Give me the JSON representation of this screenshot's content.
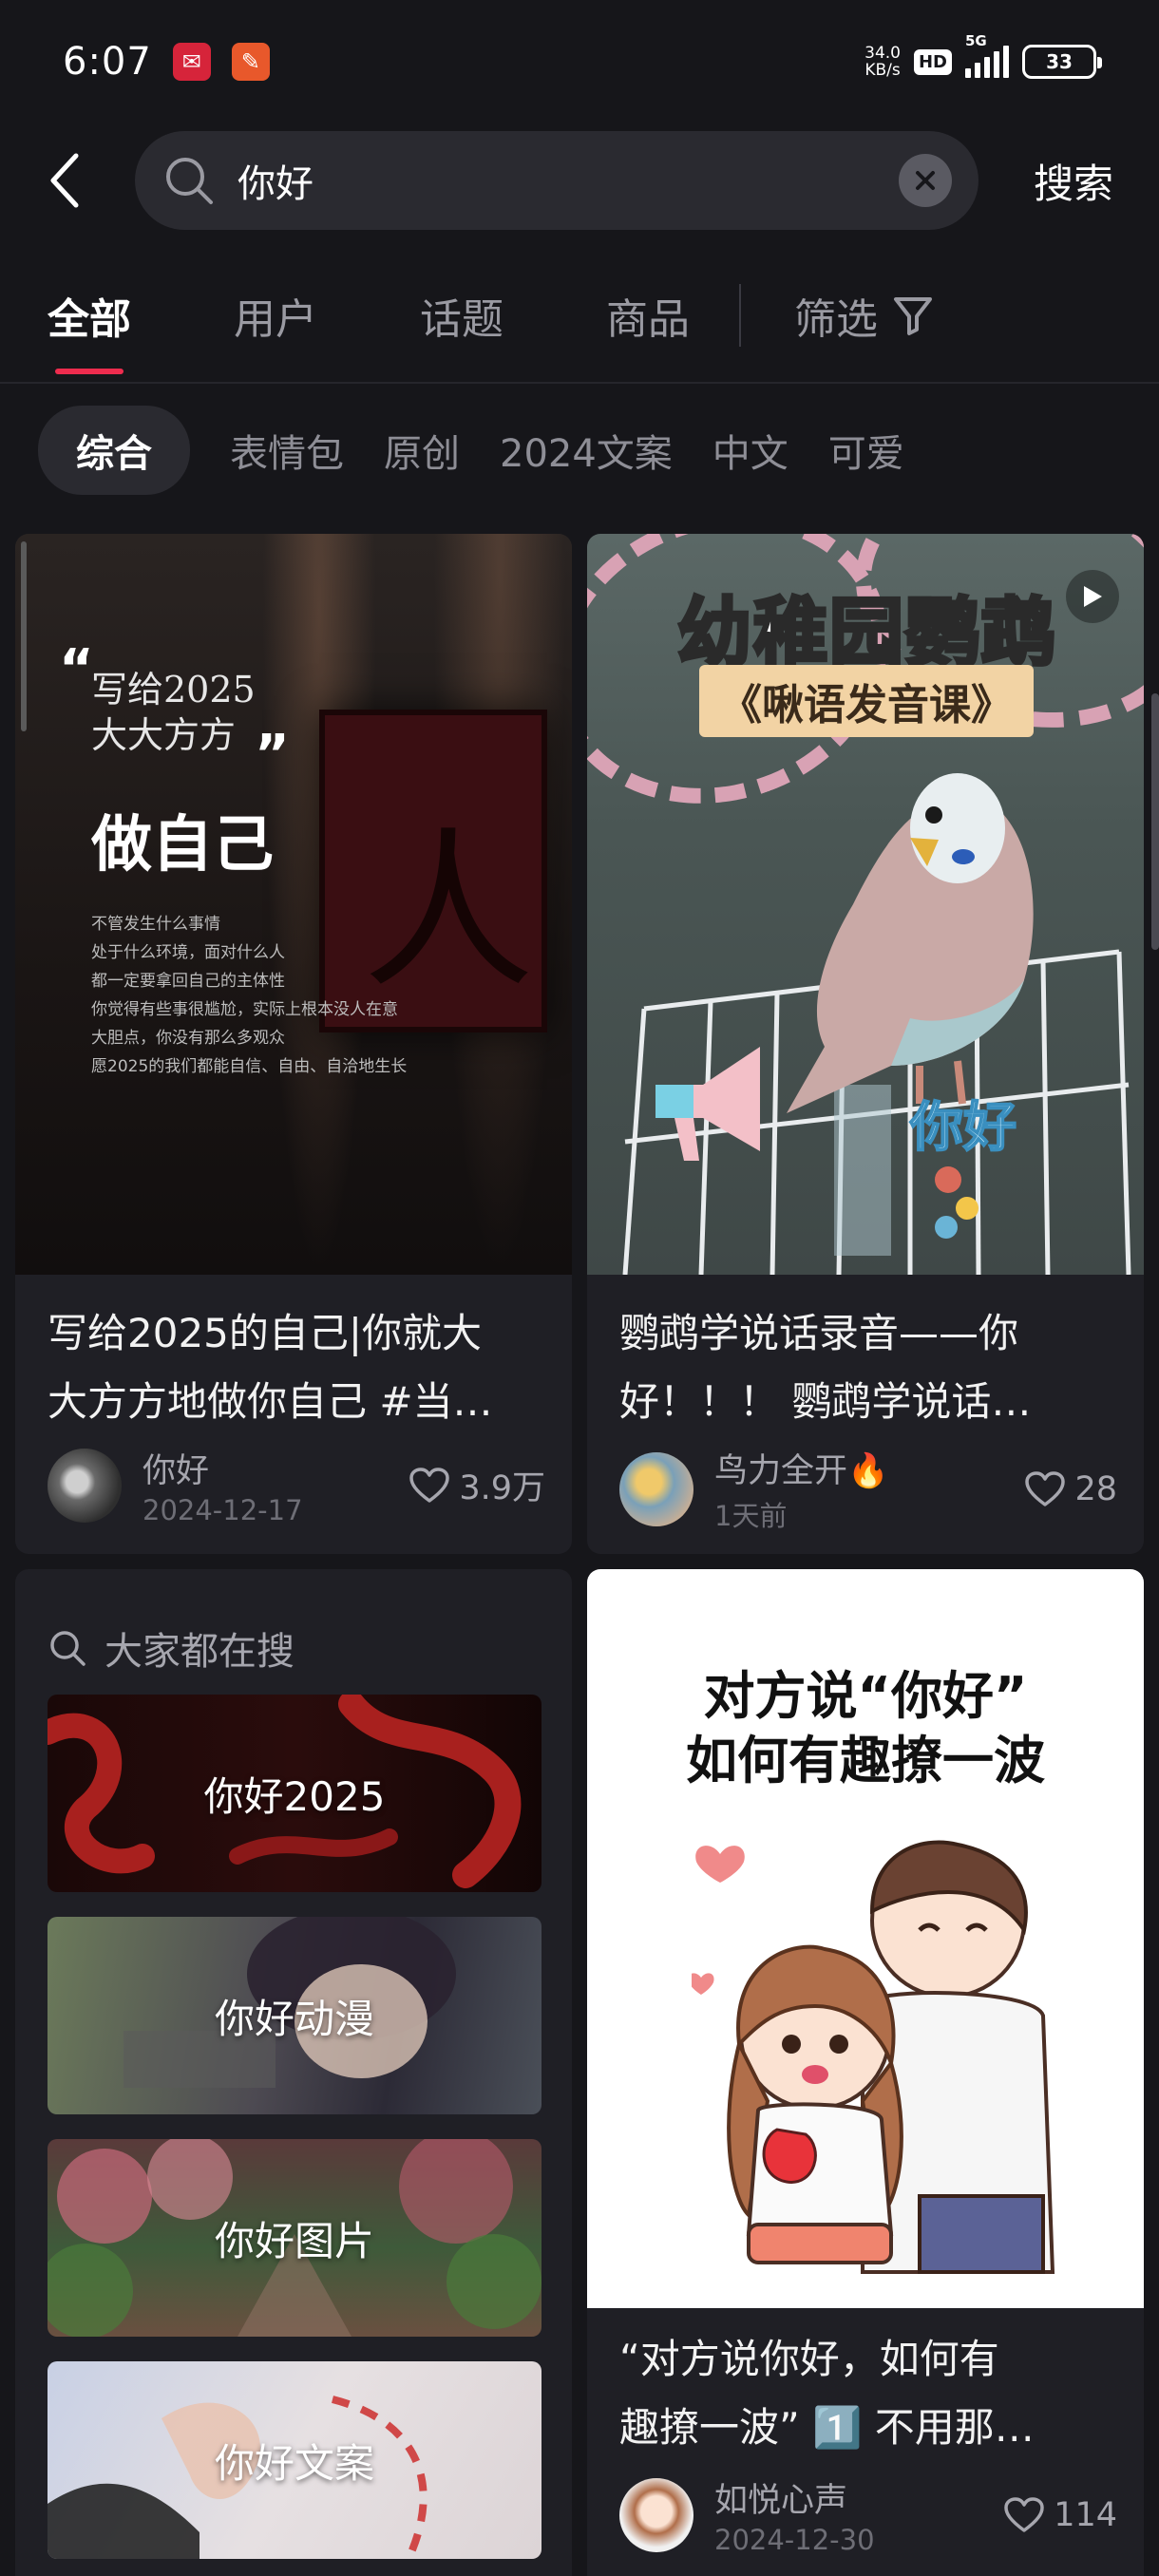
{
  "status_bar": {
    "time": "6:07",
    "net_speed_value": "34.0",
    "net_speed_unit": "KB/s",
    "hd": "HD",
    "network": "5G",
    "battery": "33"
  },
  "search": {
    "query": "你好",
    "submit_label": "搜索"
  },
  "tabs": [
    {
      "label": "全部",
      "active": true
    },
    {
      "label": "用户",
      "active": false
    },
    {
      "label": "话题",
      "active": false
    },
    {
      "label": "商品",
      "active": false
    }
  ],
  "filter_label": "筛选",
  "chips": [
    "综合",
    "表情包",
    "原创",
    "2024文案",
    "中文",
    "可爱"
  ],
  "cards": [
    {
      "title_line1": "写给2025的自己|你就大",
      "title_line2": "大方方地做你自己 #当…",
      "author": "你好",
      "date": "2024-12-17",
      "likes": "3.9万",
      "thumb_text": {
        "line1": "写给2025",
        "line2": "大大方方",
        "big": "做自己",
        "small": [
          "不管发生什么事情",
          "处于什么环境，面对什么人",
          "都一定要拿回自己的主体性",
          "你觉得有些事很尴尬，实际上根本没人在意",
          "大胆点，你没有那么多观众",
          "愿2025的我们都能自信、自由、自洽地生长"
        ]
      }
    },
    {
      "title_line1": "鹦鹉学说话录音——你",
      "title_line2": "好！！！ 鹦鹉学说话…",
      "author": "鸟力全开🔥",
      "date": "1天前",
      "likes": "28",
      "thumb_text": {
        "title": "幼稚园鹦鹉",
        "subtitle": "《啾语发音课》",
        "tag": "你好"
      }
    },
    {
      "title_line1": "“对方说你好，如何有",
      "title_line2": "趣撩一波” 1️⃣ 不用那…",
      "author": "如悦心声",
      "date": "2024-12-30",
      "likes": "114",
      "thumb_text": {
        "line1": "对方说“你好”",
        "line2": "如何有趣撩一波"
      }
    }
  ],
  "trending": {
    "header": "大家都在搜",
    "items": [
      "你好2025",
      "你好动漫",
      "你好图片",
      "你好文案"
    ]
  },
  "colors": {
    "background": "#16161a",
    "card": "#1f1f25",
    "accent": "#ee2c4e",
    "muted_text": "#9a9aa2"
  }
}
